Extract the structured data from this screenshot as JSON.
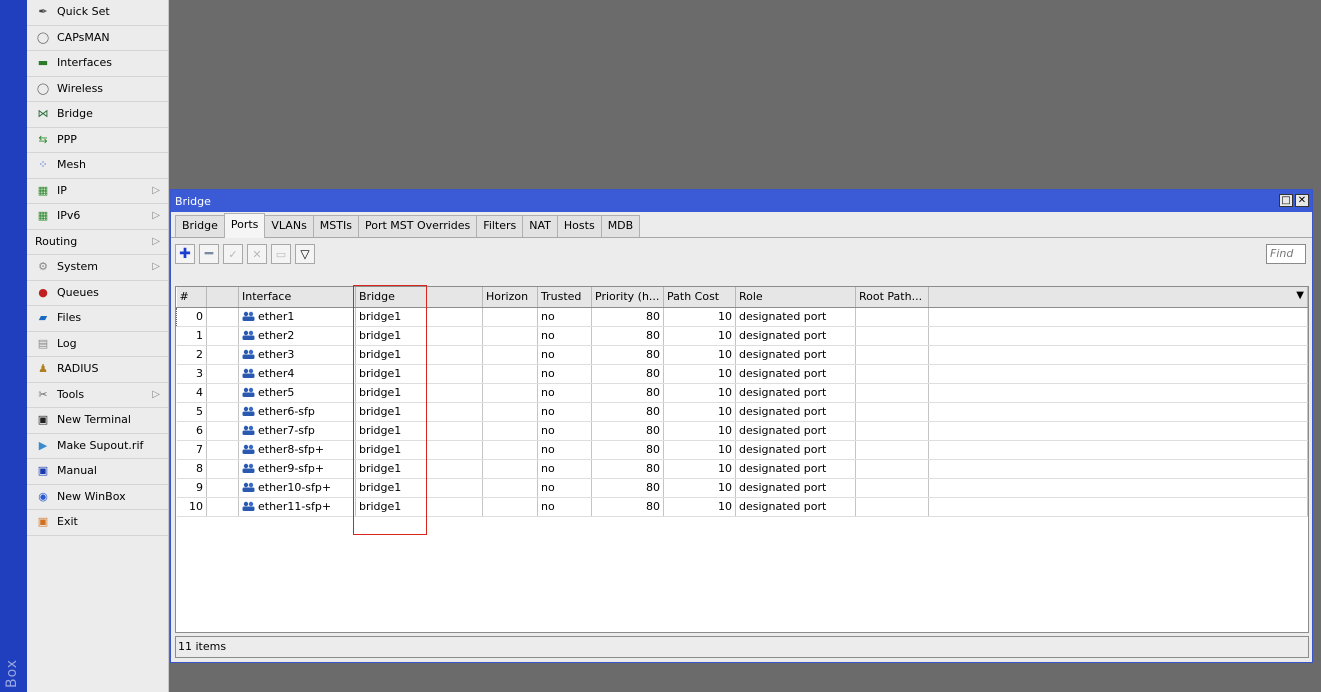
{
  "brand": {
    "text": "Box"
  },
  "sidebar": {
    "items": [
      {
        "label": "Quick Set",
        "icon": "wand-icon",
        "arrow": false
      },
      {
        "label": "CAPsMAN",
        "icon": "antenna-icon",
        "arrow": false
      },
      {
        "label": "Interfaces",
        "icon": "interfaces-icon",
        "arrow": false
      },
      {
        "label": "Wireless",
        "icon": "wireless-icon",
        "arrow": false
      },
      {
        "label": "Bridge",
        "icon": "bridge-icon",
        "arrow": false
      },
      {
        "label": "PPP",
        "icon": "ppp-icon",
        "arrow": false
      },
      {
        "label": "Mesh",
        "icon": "mesh-icon",
        "arrow": false
      },
      {
        "label": "IP",
        "icon": "ip-icon",
        "arrow": true
      },
      {
        "label": "IPv6",
        "icon": "ipv6-icon",
        "arrow": true
      },
      {
        "label": "Routing",
        "icon": "",
        "arrow": true
      },
      {
        "label": "System",
        "icon": "system-icon",
        "arrow": true
      },
      {
        "label": "Queues",
        "icon": "queues-icon",
        "arrow": false
      },
      {
        "label": "Files",
        "icon": "folder-icon",
        "arrow": false
      },
      {
        "label": "Log",
        "icon": "log-icon",
        "arrow": false
      },
      {
        "label": "RADIUS",
        "icon": "radius-icon",
        "arrow": false
      },
      {
        "label": "Tools",
        "icon": "tools-icon",
        "arrow": true
      },
      {
        "label": "New Terminal",
        "icon": "terminal-icon",
        "arrow": false
      },
      {
        "label": "Make Supout.rif",
        "icon": "supout-icon",
        "arrow": false
      },
      {
        "label": "Manual",
        "icon": "manual-icon",
        "arrow": false
      },
      {
        "label": "New WinBox",
        "icon": "winbox-icon",
        "arrow": false
      },
      {
        "label": "Exit",
        "icon": "exit-icon",
        "arrow": false
      }
    ]
  },
  "window": {
    "title": "Bridge",
    "tabs": [
      "Bridge",
      "Ports",
      "VLANs",
      "MSTIs",
      "Port MST Overrides",
      "Filters",
      "NAT",
      "Hosts",
      "MDB"
    ],
    "active_tab": "Ports",
    "find_placeholder": "Find",
    "columns": [
      "#",
      "",
      "Interface",
      "Bridge",
      "Horizon",
      "Trusted",
      "Priority (h...",
      "Path Cost",
      "Role",
      "Root Path...",
      ""
    ],
    "rows": [
      {
        "num": "0",
        "interface": "ether1",
        "bridge": "bridge1",
        "horizon": "",
        "trusted": "no",
        "priority": "80",
        "path_cost": "10",
        "role": "designated port",
        "root_path": ""
      },
      {
        "num": "1",
        "interface": "ether2",
        "bridge": "bridge1",
        "horizon": "",
        "trusted": "no",
        "priority": "80",
        "path_cost": "10",
        "role": "designated port",
        "root_path": ""
      },
      {
        "num": "2",
        "interface": "ether3",
        "bridge": "bridge1",
        "horizon": "",
        "trusted": "no",
        "priority": "80",
        "path_cost": "10",
        "role": "designated port",
        "root_path": ""
      },
      {
        "num": "3",
        "interface": "ether4",
        "bridge": "bridge1",
        "horizon": "",
        "trusted": "no",
        "priority": "80",
        "path_cost": "10",
        "role": "designated port",
        "root_path": ""
      },
      {
        "num": "4",
        "interface": "ether5",
        "bridge": "bridge1",
        "horizon": "",
        "trusted": "no",
        "priority": "80",
        "path_cost": "10",
        "role": "designated port",
        "root_path": ""
      },
      {
        "num": "5",
        "interface": "ether6-sfp",
        "bridge": "bridge1",
        "horizon": "",
        "trusted": "no",
        "priority": "80",
        "path_cost": "10",
        "role": "designated port",
        "root_path": ""
      },
      {
        "num": "6",
        "interface": "ether7-sfp",
        "bridge": "bridge1",
        "horizon": "",
        "trusted": "no",
        "priority": "80",
        "path_cost": "10",
        "role": "designated port",
        "root_path": ""
      },
      {
        "num": "7",
        "interface": "ether8-sfp+",
        "bridge": "bridge1",
        "horizon": "",
        "trusted": "no",
        "priority": "80",
        "path_cost": "10",
        "role": "designated port",
        "root_path": ""
      },
      {
        "num": "8",
        "interface": "ether9-sfp+",
        "bridge": "bridge1",
        "horizon": "",
        "trusted": "no",
        "priority": "80",
        "path_cost": "10",
        "role": "designated port",
        "root_path": ""
      },
      {
        "num": "9",
        "interface": "ether10-sfp+",
        "bridge": "bridge1",
        "horizon": "",
        "trusted": "no",
        "priority": "80",
        "path_cost": "10",
        "role": "designated port",
        "root_path": ""
      },
      {
        "num": "10",
        "interface": "ether11-sfp+",
        "bridge": "bridge1",
        "horizon": "",
        "trusted": "no",
        "priority": "80",
        "path_cost": "10",
        "role": "designated port",
        "root_path": ""
      }
    ],
    "status": "11 items"
  },
  "colors": {
    "titlebar": "#3b5bd6",
    "brand_strip": "#1f3fbf",
    "highlight_box": "#d9261c",
    "desktop": "#6b6b6b"
  }
}
